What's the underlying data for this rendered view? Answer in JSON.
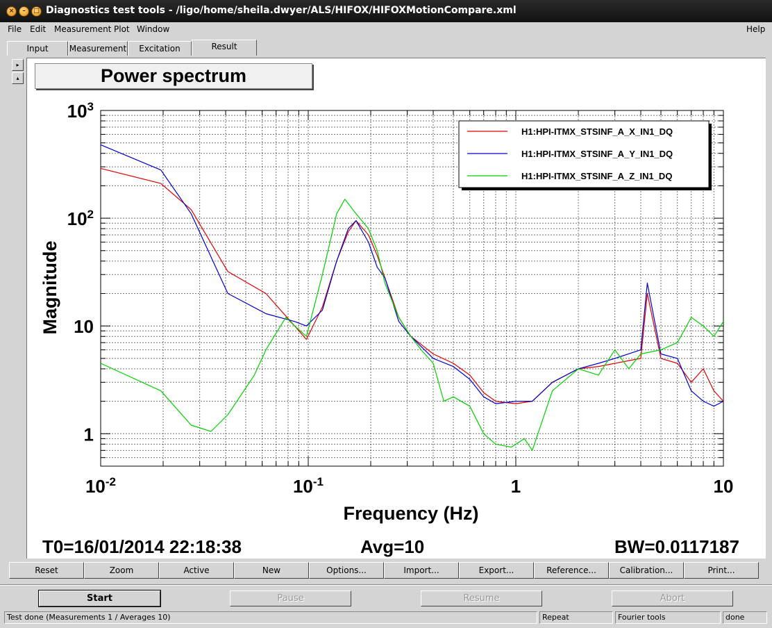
{
  "window": {
    "title": "Diagnostics test tools - /ligo/home/sheila.dwyer/ALS/HIFOX/HIFOXMotionCompare.xml"
  },
  "menu": {
    "file": "File",
    "edit": "Edit",
    "measurement": "Measurement",
    "plot": "Plot",
    "window": "Window",
    "help": "Help"
  },
  "tabs": [
    "Input",
    "Measurement",
    "Excitation",
    "Result"
  ],
  "side_buttons": {
    "right": "▸",
    "up": "▴"
  },
  "plot": {
    "title": "Power spectrum",
    "xlabel": "Frequency (Hz)",
    "ylabel": "Magnitude",
    "x_ticks": [
      {
        "base": "10",
        "exp": "-2"
      },
      {
        "base": "10",
        "exp": "-1"
      },
      {
        "base": "1",
        "exp": ""
      },
      {
        "base": "10",
        "exp": ""
      }
    ],
    "y_ticks": [
      {
        "base": "1",
        "exp": ""
      },
      {
        "base": "10",
        "exp": ""
      },
      {
        "base": "10",
        "exp": "2"
      },
      {
        "base": "10",
        "exp": "3"
      }
    ],
    "t0": "T0=16/01/2014 22:18:38",
    "avg": "Avg=10",
    "bw": "BW=0.0117187"
  },
  "chart_data": {
    "type": "line",
    "title": "Power spectrum",
    "xlabel": "Frequency (Hz)",
    "ylabel": "Magnitude",
    "x_scale": "log",
    "y_scale": "log",
    "xlim": [
      0.01,
      10
    ],
    "ylim": [
      0.5,
      1000
    ],
    "grid": true,
    "legend_position": "top-right",
    "series": [
      {
        "name": "H1:HPI-ITMX_STSINF_A_X_IN1_DQ",
        "color": "#e00000",
        "x": [
          0.01,
          0.0195,
          0.0273,
          0.041,
          0.0625,
          0.086,
          0.098,
          0.117,
          0.137,
          0.156,
          0.17,
          0.195,
          0.215,
          0.234,
          0.273,
          0.312,
          0.4,
          0.5,
          0.6,
          0.7,
          0.8,
          1.0,
          1.2,
          1.5,
          2.0,
          2.5,
          3.0,
          4.0,
          4.3,
          5.0,
          6.0,
          7.0,
          8.0,
          9.0,
          10.0
        ],
        "y": [
          290,
          210,
          120,
          32,
          20,
          10,
          7.5,
          15,
          40,
          75,
          95,
          70,
          45,
          28,
          12,
          8,
          5.5,
          4.5,
          3.5,
          2.4,
          2.0,
          1.9,
          2.0,
          3.0,
          4.0,
          4.2,
          4.5,
          5.0,
          20,
          5.0,
          4.5,
          3.0,
          4.0,
          2.5,
          2.0
        ]
      },
      {
        "name": "H1:HPI-ITMX_STSINF_A_Y_IN1_DQ",
        "color": "#0000d0",
        "x": [
          0.01,
          0.0195,
          0.0273,
          0.041,
          0.0625,
          0.086,
          0.098,
          0.117,
          0.137,
          0.156,
          0.17,
          0.195,
          0.215,
          0.234,
          0.273,
          0.312,
          0.4,
          0.5,
          0.6,
          0.7,
          0.8,
          1.0,
          1.2,
          1.5,
          2.0,
          2.5,
          3.0,
          4.0,
          4.3,
          5.0,
          6.0,
          7.0,
          8.0,
          9.0,
          10.0
        ],
        "y": [
          480,
          280,
          110,
          20,
          13,
          11,
          10,
          14,
          40,
          80,
          95,
          60,
          35,
          28,
          11,
          8,
          5.0,
          4.2,
          3.2,
          2.2,
          1.9,
          2.0,
          2.0,
          3.0,
          4.0,
          4.5,
          5.0,
          6.0,
          25,
          5.5,
          5.0,
          2.5,
          2.0,
          1.8,
          2.0
        ]
      },
      {
        "name": "H1:HPI-ITMX_STSINF_A_Z_IN1_DQ",
        "color": "#00d000",
        "x": [
          0.01,
          0.0195,
          0.0273,
          0.034,
          0.041,
          0.055,
          0.0625,
          0.078,
          0.086,
          0.098,
          0.117,
          0.137,
          0.15,
          0.17,
          0.195,
          0.215,
          0.234,
          0.273,
          0.312,
          0.35,
          0.4,
          0.45,
          0.5,
          0.6,
          0.7,
          0.8,
          0.95,
          1.1,
          1.2,
          1.5,
          2.0,
          2.5,
          3.0,
          3.5,
          4.0,
          5.0,
          6.0,
          7.0,
          8.0,
          9.0,
          10.0
        ],
        "y": [
          4.5,
          2.5,
          1.2,
          1.05,
          1.5,
          3.5,
          6.0,
          12,
          10,
          8.0,
          30,
          110,
          150,
          110,
          80,
          50,
          25,
          12,
          8,
          6,
          4.5,
          2.0,
          2.2,
          1.8,
          1.0,
          0.8,
          0.75,
          0.9,
          0.7,
          2.5,
          4.0,
          3.5,
          6.0,
          4.0,
          5.5,
          6.0,
          7.0,
          12,
          10,
          8.0,
          11
        ]
      }
    ]
  },
  "toolbar": [
    "Reset",
    "Zoom",
    "Active",
    "New",
    "Options...",
    "Import...",
    "Export...",
    "Reference...",
    "Calibration...",
    "Print..."
  ],
  "controls": {
    "start": "Start",
    "pause": "Pause",
    "resume": "Resume",
    "abort": "Abort"
  },
  "status": {
    "message": "Test done (Measurements 1 / Averages 10)",
    "repeat": "Repeat",
    "tool": "Fourier tools",
    "state": "done"
  }
}
